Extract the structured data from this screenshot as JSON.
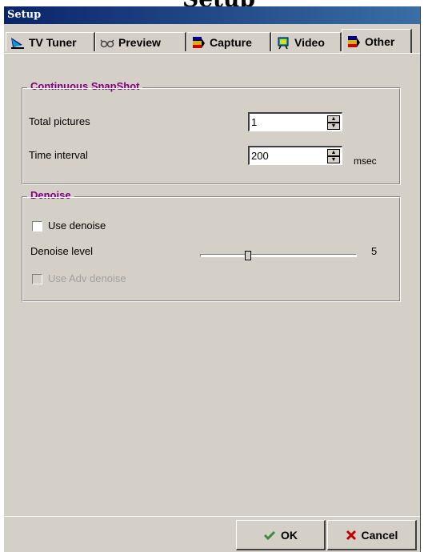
{
  "window": {
    "title": "Setup",
    "behind_title_fragment": "Setup"
  },
  "tabs": [
    {
      "label": "TV Tuner",
      "icon": "tv-tuner-icon",
      "active": false
    },
    {
      "label": "Preview",
      "icon": "preview-glasses-icon",
      "active": false
    },
    {
      "label": "Capture",
      "icon": "capture-icon",
      "active": false
    },
    {
      "label": "Video",
      "icon": "video-icon",
      "active": false
    },
    {
      "label": "Other",
      "icon": "other-icon",
      "active": true
    }
  ],
  "snapshot": {
    "title": "Continuous SnapShot",
    "total_label": "Total pictures",
    "total_value": "1",
    "interval_label": "Time interval",
    "interval_value": "200",
    "interval_unit": "msec"
  },
  "denoise": {
    "title": "Denoise",
    "use_label": "Use denoise",
    "use_checked": false,
    "level_label": "Denoise level",
    "level_value": "5",
    "adv_label": "Use Adv denoise",
    "adv_enabled": false
  },
  "buttons": {
    "ok_label": "OK",
    "cancel_label": "Cancel"
  },
  "colors": {
    "titlebar": "#0a246a",
    "group_title": "#800080",
    "ok_check": "#3c8a3c",
    "cancel_x": "#c00000"
  }
}
